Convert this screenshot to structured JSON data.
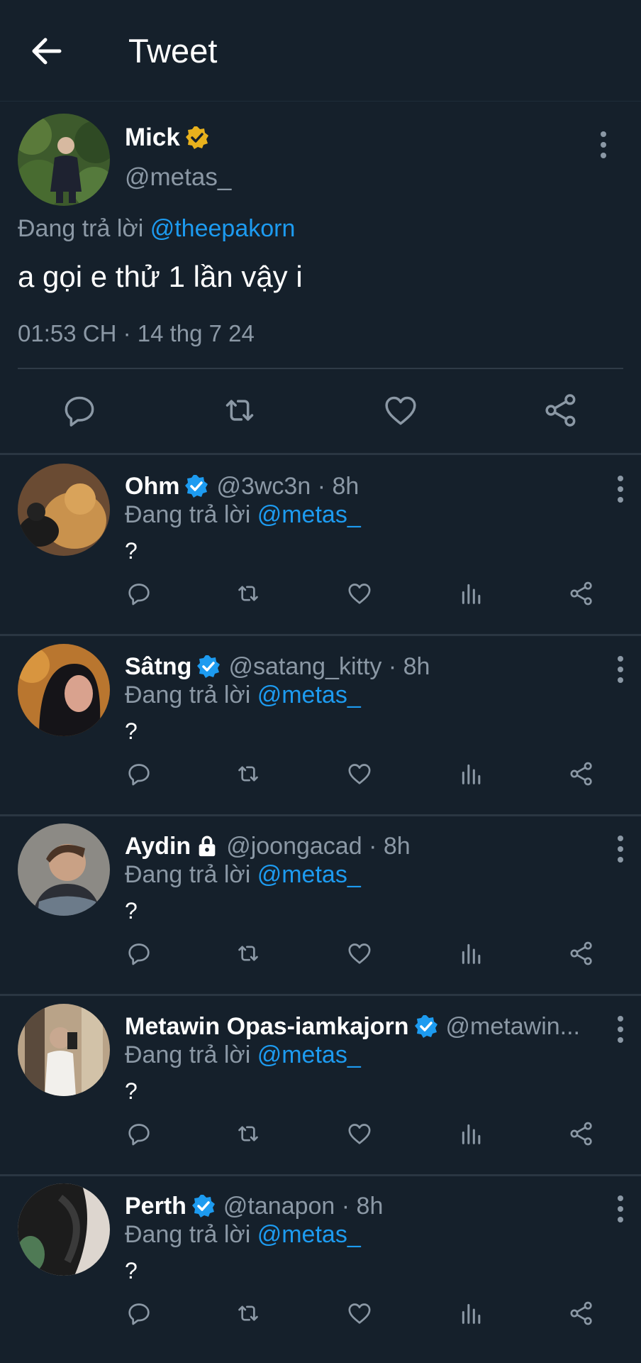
{
  "header": {
    "title": "Tweet"
  },
  "main_tweet": {
    "name": "Mick",
    "badge": "gold-verified-badge",
    "handle": "@metas_",
    "replying_prefix": "Đang trả lời",
    "replying_to": "@theepakorn",
    "text": "a gọi e thử 1 lần vậy i",
    "timestamp": "01:53 CH · 14 thg 7 24"
  },
  "replies": [
    {
      "name": "Ohm",
      "badge": "blue-verified",
      "meta": "@3wc3n · 8h",
      "replying_prefix": "Đang trả lời",
      "replying_to": "@metas_",
      "text": "?"
    },
    {
      "name": "Sâtng",
      "badge": "blue-verified",
      "meta": "@satang_kitty · 8h",
      "replying_prefix": "Đang trả lời",
      "replying_to": "@metas_",
      "text": "?"
    },
    {
      "name": "Aydin",
      "badge": "lock",
      "meta": "@joongacad · 8h",
      "replying_prefix": "Đang trả lời",
      "replying_to": "@metas_",
      "text": "?"
    },
    {
      "name": "Metawin Opas-iamkajorn",
      "badge": "blue-verified",
      "meta": "@metawin...",
      "replying_prefix": "Đang trả lời",
      "replying_to": "@metas_",
      "text": "?"
    },
    {
      "name": "Perth",
      "badge": "blue-verified",
      "meta": "@tanapon · 8h",
      "replying_prefix": "Đang trả lời",
      "replying_to": "@metas_",
      "text": "?"
    }
  ],
  "colors": {
    "background": "#15202b",
    "link": "#1d9bf0",
    "muted": "#8b98a5",
    "gold_badge": "#e8b11d",
    "blue_badge": "#1d9bf0"
  }
}
